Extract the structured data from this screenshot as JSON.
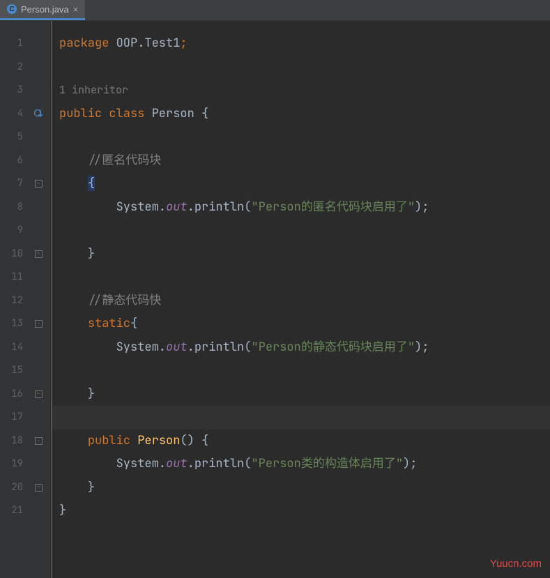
{
  "tab": {
    "filename": "Person.java",
    "icon_letter": "C"
  },
  "gutter": {
    "lines": [
      "1",
      "2",
      "",
      "3",
      "4",
      "5",
      "6",
      "7",
      "8",
      "9",
      "10",
      "11",
      "12",
      "13",
      "14",
      "15",
      "16",
      "17",
      "18",
      "19",
      "20",
      "21"
    ]
  },
  "hint": {
    "inheritor": "1 inheritor"
  },
  "code": {
    "l1_kw": "package",
    "l1_pkg": " OOP.Test1",
    "l1_semi": ";",
    "l3_kw1": "public",
    "l3_kw2": "class",
    "l3_name": " Person ",
    "l3_brace": "{",
    "l5_cmt": "//匿名代码块",
    "l6_brace": "{",
    "l7_sys": "System.",
    "l7_out": "out",
    "l7_dot": ".",
    "l7_pl": "println",
    "l7_op": "(",
    "l7_str": "\"Person的匿名代码块启用了\"",
    "l7_cp": ");",
    "l9_brace": "}",
    "l11_cmt": "//静态代码快",
    "l12_kw": "static",
    "l12_brace": "{",
    "l13_sys": "System.",
    "l13_out": "out",
    "l13_dot": ".",
    "l13_pl": "println",
    "l13_op": "(",
    "l13_str": "\"Person的静态代码块启用了\"",
    "l13_cp": ");",
    "l15_brace": "}",
    "l17_kw": "public",
    "l17_name": " Person",
    "l17_par": "() ",
    "l17_brace": "{",
    "l18_sys": "System.",
    "l18_out": "out",
    "l18_dot": ".",
    "l18_pl": "println",
    "l18_op": "(",
    "l18_str": "\"Person类的构造体启用了\"",
    "l18_cp": ");",
    "l19_brace": "}",
    "l20_brace": "}"
  },
  "watermark": "Yuucn.com"
}
